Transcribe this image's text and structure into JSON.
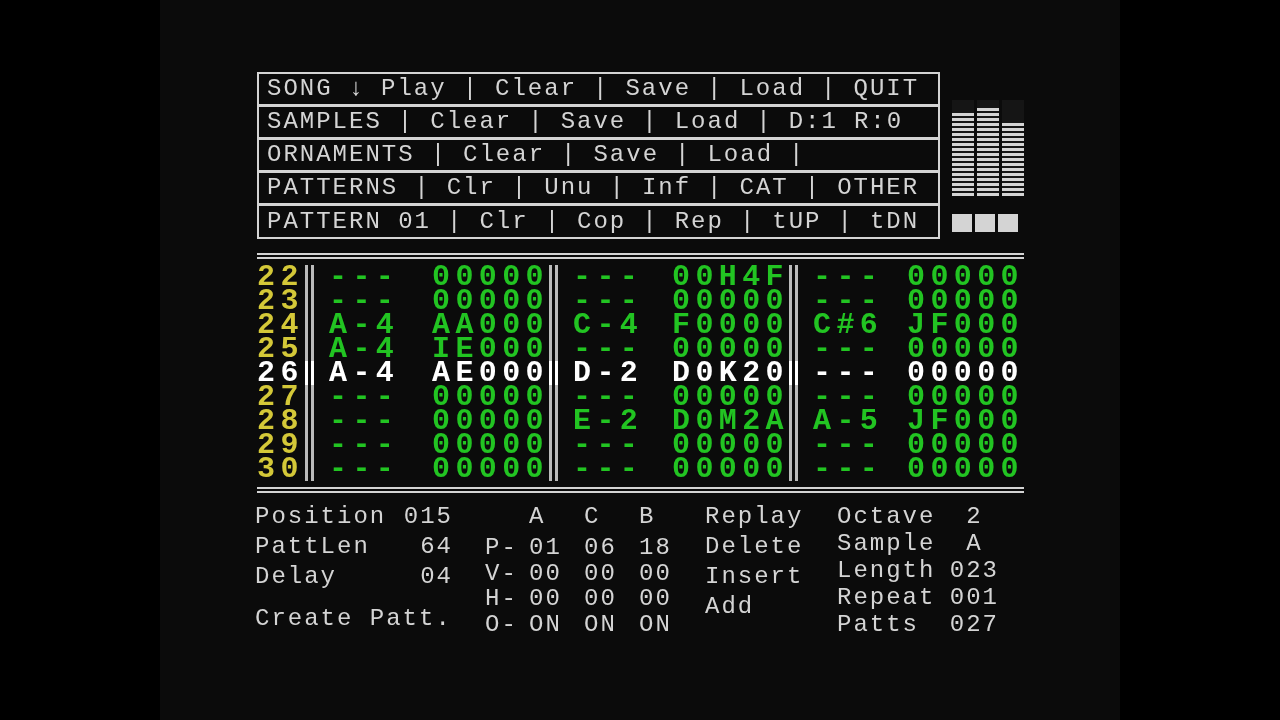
{
  "menu_rows": [
    {
      "segments": [
        {
          "items": [
            "SONG",
            "↓",
            "Play"
          ],
          "separator": "|"
        },
        {
          "items": [
            "Clear"
          ],
          "separator": "|"
        },
        {
          "items": [
            "Save"
          ],
          "separator": "|"
        },
        {
          "items": [
            "Load"
          ],
          "separator": "|"
        },
        {
          "items": [
            "QUIT"
          ]
        }
      ]
    },
    {
      "segments": [
        {
          "items": [
            "SAMPLES"
          ],
          "separator": "|"
        },
        {
          "items": [
            "Clear"
          ],
          "separator": "|"
        },
        {
          "items": [
            "Save"
          ],
          "separator": "|"
        },
        {
          "items": [
            "Load"
          ],
          "separator": "|"
        },
        {
          "items": [
            "D:1",
            "R:0"
          ]
        }
      ]
    },
    {
      "segments": [
        {
          "items": [
            "ORNAMENTS"
          ],
          "separator": "|"
        },
        {
          "items": [
            "Clear"
          ],
          "separator": "|"
        },
        {
          "items": [
            "Save"
          ],
          "separator": "|"
        },
        {
          "items": [
            "Load"
          ],
          "separator": "|"
        }
      ]
    },
    {
      "segments": [
        {
          "items": [
            "PATTERNS"
          ],
          "separator": "|"
        },
        {
          "items": [
            "Clr"
          ],
          "separator": "|"
        },
        {
          "items": [
            "Unu"
          ],
          "separator": "|"
        },
        {
          "items": [
            "Inf"
          ],
          "separator": "|"
        },
        {
          "items": [
            "CAT"
          ],
          "separator": "|"
        },
        {
          "items": [
            "OTHER"
          ]
        }
      ]
    },
    {
      "segments": [
        {
          "items": [
            "PATTERN 01"
          ],
          "separator": "|"
        },
        {
          "items": [
            "Clr"
          ],
          "separator": "|"
        },
        {
          "items": [
            "Cop"
          ],
          "separator": "|"
        },
        {
          "items": [
            "Rep"
          ],
          "separator": "|"
        },
        {
          "items": [
            "tUP"
          ],
          "separator": "|"
        },
        {
          "items": [
            "tDN"
          ]
        }
      ]
    }
  ],
  "meters": [
    {
      "level": 0.88
    },
    {
      "level": 0.94
    },
    {
      "level": 0.76
    }
  ],
  "tracker_rows": [
    {
      "number": "22",
      "selected": false,
      "cells": [
        {
          "note": "---",
          "effect": "00000"
        },
        {
          "note": "---",
          "effect": "00H4F"
        },
        {
          "note": "---",
          "effect": "00000"
        }
      ]
    },
    {
      "number": "23",
      "selected": false,
      "cells": [
        {
          "note": "---",
          "effect": "00000"
        },
        {
          "note": "---",
          "effect": "00000"
        },
        {
          "note": "---",
          "effect": "00000"
        }
      ]
    },
    {
      "number": "24",
      "selected": false,
      "cells": [
        {
          "note": "A-4",
          "effect": "AA000"
        },
        {
          "note": "C-4",
          "effect": "F0000"
        },
        {
          "note": "C#6",
          "effect": "JF000"
        }
      ]
    },
    {
      "number": "25",
      "selected": false,
      "cells": [
        {
          "note": "A-4",
          "effect": "IE000"
        },
        {
          "note": "---",
          "effect": "00000"
        },
        {
          "note": "---",
          "effect": "00000"
        }
      ]
    },
    {
      "number": "26",
      "selected": true,
      "cells": [
        {
          "note": "A-4",
          "effect": "AE000"
        },
        {
          "note": "D-2",
          "effect": "D0K20"
        },
        {
          "note": "---",
          "effect": "00000"
        }
      ]
    },
    {
      "number": "27",
      "selected": false,
      "cells": [
        {
          "note": "---",
          "effect": "00000"
        },
        {
          "note": "---",
          "effect": "00000"
        },
        {
          "note": "---",
          "effect": "00000"
        }
      ]
    },
    {
      "number": "28",
      "selected": false,
      "cells": [
        {
          "note": "---",
          "effect": "00000"
        },
        {
          "note": "E-2",
          "effect": "D0M2A"
        },
        {
          "note": "A-5",
          "effect": "JF000"
        }
      ]
    },
    {
      "number": "29",
      "selected": false,
      "cells": [
        {
          "note": "---",
          "effect": "00000"
        },
        {
          "note": "---",
          "effect": "00000"
        },
        {
          "note": "---",
          "effect": "00000"
        }
      ]
    },
    {
      "number": "30",
      "selected": false,
      "cells": [
        {
          "note": "---",
          "effect": "00000"
        },
        {
          "note": "---",
          "effect": "00000"
        },
        {
          "note": "---",
          "effect": "00000"
        }
      ]
    }
  ],
  "song_info": [
    {
      "label": "Position",
      "value": "015"
    },
    {
      "label": "PattLen",
      "value": "64"
    },
    {
      "label": "Delay",
      "value": "04"
    }
  ],
  "create_button": "Create Patt.",
  "channel_table": {
    "columns": [
      "A",
      "C",
      "B"
    ],
    "rows": [
      {
        "label": "P-",
        "values": [
          "01",
          "06",
          "18"
        ]
      },
      {
        "label": "V-",
        "values": [
          "00",
          "00",
          "00"
        ]
      },
      {
        "label": "H-",
        "values": [
          "00",
          "00",
          "00"
        ]
      },
      {
        "label": "O-",
        "values": [
          "ON",
          "ON",
          "ON"
        ]
      }
    ]
  },
  "actions": [
    "Replay",
    "Delete",
    "Insert",
    "Add"
  ],
  "sample_info": [
    {
      "label": "Octave",
      "value": "2"
    },
    {
      "label": "Sample",
      "value": "A"
    },
    {
      "label": "Length",
      "value": "023"
    },
    {
      "label": "Repeat",
      "value": "001"
    },
    {
      "label": "Patts",
      "value": "027"
    }
  ]
}
